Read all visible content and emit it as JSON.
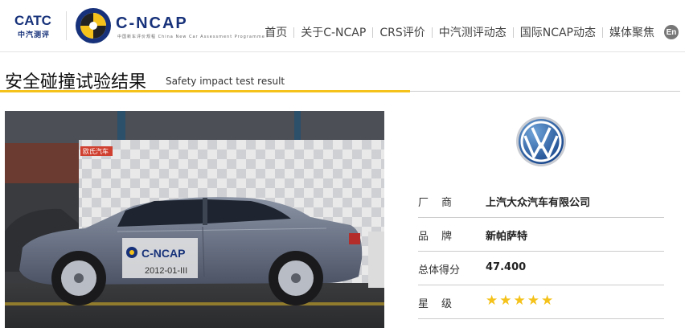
{
  "header": {
    "catc_logo_text": "CATC",
    "catc_logo_sub": "中汽测评",
    "ncap_logo_text": "C-NCAP",
    "ncap_logo_sub": "中国新车评价规程 China New Car Assessment Programme",
    "nav": [
      "首页",
      "关于C-NCAP",
      "CRS评价",
      "中汽测评动态",
      "国际NCAP动态",
      "媒体聚焦"
    ],
    "lang_button": "En"
  },
  "section": {
    "title_cn": "安全碰撞试验结果",
    "title_en": "Safety impact test result",
    "accent_color": "#f4c21a"
  },
  "photo": {
    "car_door_label": "C-NCAP",
    "car_test_id": "2012-01-III",
    "banner_text": "欧氏汽车"
  },
  "info": {
    "manufacturer_label": "厂商",
    "manufacturer_value": "上汽大众汽车有限公司",
    "brand_label": "品牌",
    "brand_value": "新帕萨特",
    "score_label": "总体得分",
    "score_value": "47.400",
    "rating_label": "星级",
    "rating_stars": "★★★★★",
    "rating_count": 5,
    "star_color": "#f4c21a"
  }
}
